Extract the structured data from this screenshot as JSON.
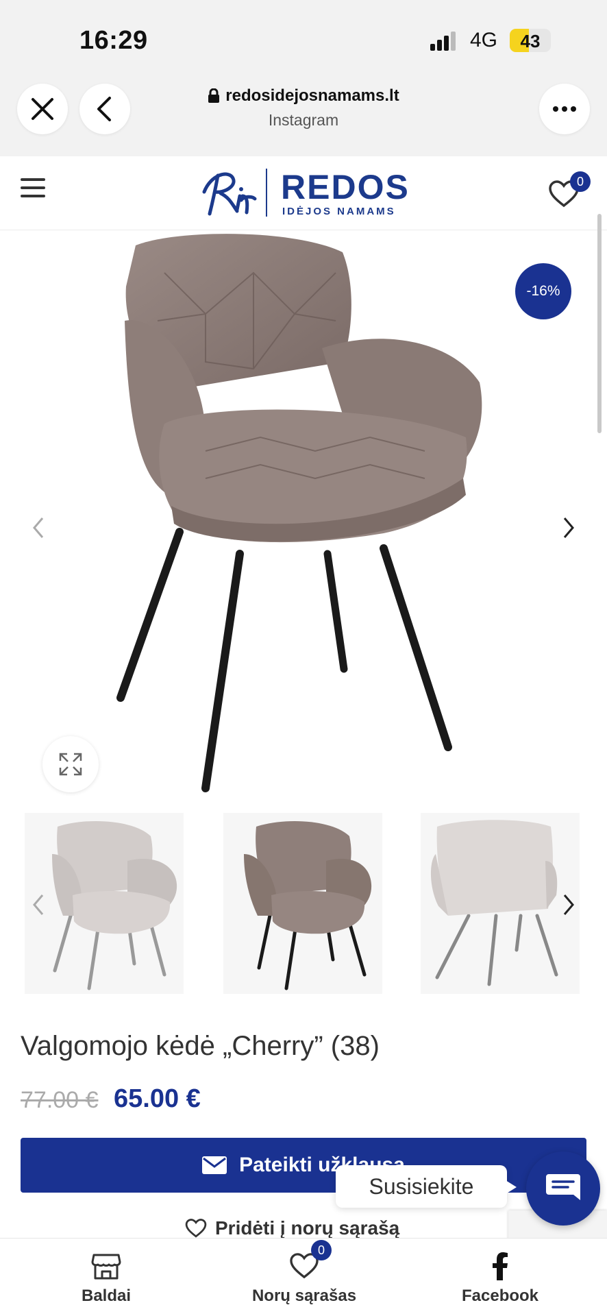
{
  "status_bar": {
    "time": "16:29",
    "network": "4G",
    "battery": "43"
  },
  "browser": {
    "url": "redosidejosnamams.lt",
    "source": "Instagram"
  },
  "header": {
    "brand": "REDOS",
    "brand_sub": "IDĖJOS NAMAMS",
    "wishlist_count": "0"
  },
  "product": {
    "discount": "-16%",
    "title": "Valgomojo kėdė „Cherry” (38)",
    "old_price": "77.00 €",
    "new_price": "65.00 €",
    "inquiry_label": "Pateikti užklausą",
    "wishlist_label": "Pridėti į norų sąrašą",
    "main_color": "#8a7a76"
  },
  "thumbnails": [
    {
      "name": "light-grey-front"
    },
    {
      "name": "brown-front"
    },
    {
      "name": "light-grey-back"
    }
  ],
  "contact": {
    "label": "Susisiekite"
  },
  "bottom_nav": {
    "furniture": "Baldai",
    "wishlist": "Norų sąrašas",
    "wishlist_count": "0",
    "facebook": "Facebook"
  },
  "colors": {
    "accent": "#1a3291",
    "logo": "#1c3a8c"
  }
}
